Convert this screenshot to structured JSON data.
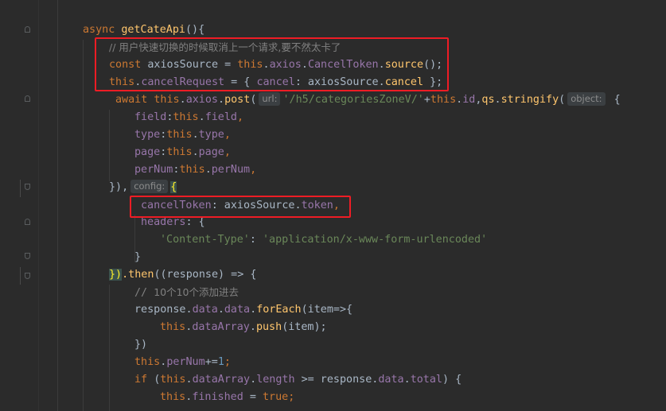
{
  "code": {
    "l0_async": "async ",
    "l0_name": "getCateApi",
    "l0_rest": "(){",
    "l1_comment": "// 用户快速切换的时候取消上一个请求,要不然太卡了",
    "l2_const": "const ",
    "l2_var": "axiosSource = ",
    "l2_this": "this",
    "l2_dot1": ".",
    "l2_axios": "axios",
    "l2_dot2": ".",
    "l2_ct": "CancelToken",
    "l2_dot3": ".",
    "l2_source": "source",
    "l2_end": "();",
    "l3_this": "this",
    "l3_dot": ".",
    "l3_cancelReq": "cancelRequest",
    "l3_mid": " = { ",
    "l3_cancel": "cancel",
    "l3_colon": ": axiosSource.",
    "l3_cancel2": "cancel",
    "l3_end": " };",
    "l4_await": "await ",
    "l4_this": "this",
    "l4_dot1": ".",
    "l4_axios": "axios",
    "l4_dot2": ".",
    "l4_post": "post",
    "l4_paren": "(",
    "l4_hint_url": "url:",
    "l4_str": "'/h5/categoriesZoneV/'",
    "l4_plus": "+",
    "l4_this2": "this",
    "l4_dot3": ".",
    "l4_id": "id",
    "l4_comma": ",",
    "l4_qs": "qs",
    "l4_dot4": ".",
    "l4_stringify": "stringify",
    "l4_paren2": "(",
    "l4_hint_obj": "object:",
    "l4_brace": " {",
    "l5_key": "field",
    "l5_colon": ":",
    "l5_this": "this",
    "l5_dot": ".",
    "l5_val": "field",
    "l5_comma": ",",
    "l6_key": "type",
    "l6_colon": ":",
    "l6_this": "this",
    "l6_dot": ".",
    "l6_val": "type",
    "l6_comma": ",",
    "l7_key": "page",
    "l7_colon": ":",
    "l7_this": "this",
    "l7_dot": ".",
    "l7_val": "page",
    "l7_comma": ",",
    "l8_key": "perNum",
    "l8_colon": ":",
    "l8_this": "this",
    "l8_dot": ".",
    "l8_val": "perNum",
    "l8_comma": ",",
    "l9_close": "}),",
    "l9_hint_config": "config:",
    "l9_brace": "{",
    "l10_key": "cancelToken",
    "l10_colon": ": axiosSource.",
    "l10_token": "token",
    "l10_comma": ",",
    "l11_key": "headers",
    "l11_rest": ": {",
    "l12_str1": "'Content-Type'",
    "l12_colon": ": ",
    "l12_str2": "'application/x-www-form-urlencoded'",
    "l13_close": "}",
    "l14_close": "})",
    "l14_then": ".then",
    "l14_rest": "((response) => {",
    "l15_comment_a": "// ",
    "l15_comment_b": "10个10个添加进去",
    "l16_resp": "response.",
    "l16_data1": "data",
    "l16_dot": ".",
    "l16_data2": "data",
    "l16_dot2": ".",
    "l16_forEach": "forEach",
    "l16_rest": "(item=>{",
    "l17_this": "this",
    "l17_dot": ".",
    "l17_arr": "dataArray",
    "l17_dot2": ".",
    "l17_push": "push",
    "l17_rest": "(item);",
    "l18_close": "})",
    "l19_this": "this",
    "l19_dot": ".",
    "l19_prop": "perNum",
    "l19_op": "+=",
    "l19_num": "1",
    "l19_semi": ";",
    "l20_if": "if ",
    "l20_paren": "(",
    "l20_this": "this",
    "l20_dot": ".",
    "l20_arr": "dataArray",
    "l20_dot2": ".",
    "l20_len": "length",
    "l20_mid": " >= response.",
    "l20_data": "data",
    "l20_dot3": ".",
    "l20_total": "total",
    "l20_end": ") {",
    "l21_this": "this",
    "l21_dot": ".",
    "l21_fin": "finished",
    "l21_eq": " = ",
    "l21_true": "true",
    "l21_semi": ";"
  },
  "colors": {
    "background": "#2b2b2b",
    "keyword": "#cc7832",
    "function": "#ffc66d",
    "property": "#9876aa",
    "string": "#6a8759",
    "number": "#6897bb",
    "comment": "#808080",
    "highlight_box": "#ee1c25"
  }
}
